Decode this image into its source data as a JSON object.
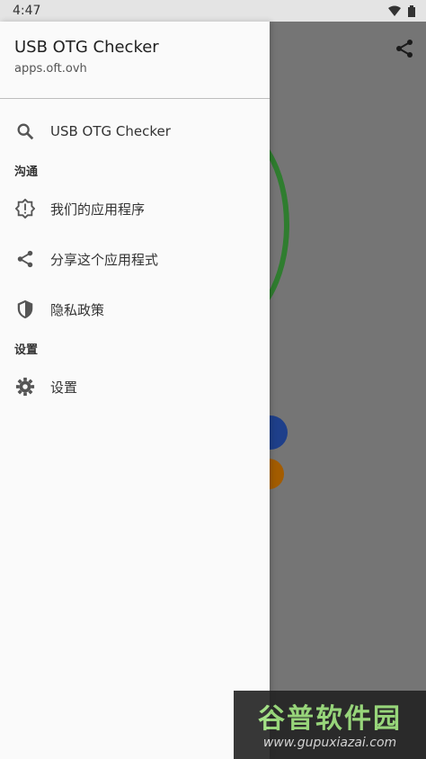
{
  "status": {
    "time": "4:47"
  },
  "drawer": {
    "title": "USB OTG Checker",
    "subtitle": "apps.oft.ovh",
    "items_top": [
      {
        "label": "USB OTG Checker",
        "icon": "search-icon"
      }
    ],
    "section_communication": "沟通",
    "items_communication": [
      {
        "label": "我们的应用程序",
        "icon": "info-badge-icon"
      },
      {
        "label": "分享这个应用程式",
        "icon": "share-icon"
      },
      {
        "label": "隐私政策",
        "icon": "shield-icon"
      }
    ],
    "section_settings": "设置",
    "items_settings": [
      {
        "label": "设置",
        "icon": "gear-icon"
      }
    ]
  },
  "watermark": {
    "title": "谷普软件园",
    "url": "www.gupuxiazai.com"
  },
  "colors": {
    "scrim": "#757575",
    "drawer_bg": "#fafafa",
    "ring": "#2f7d2f",
    "blue": "#1e3f8a",
    "orange": "#a35c00"
  }
}
